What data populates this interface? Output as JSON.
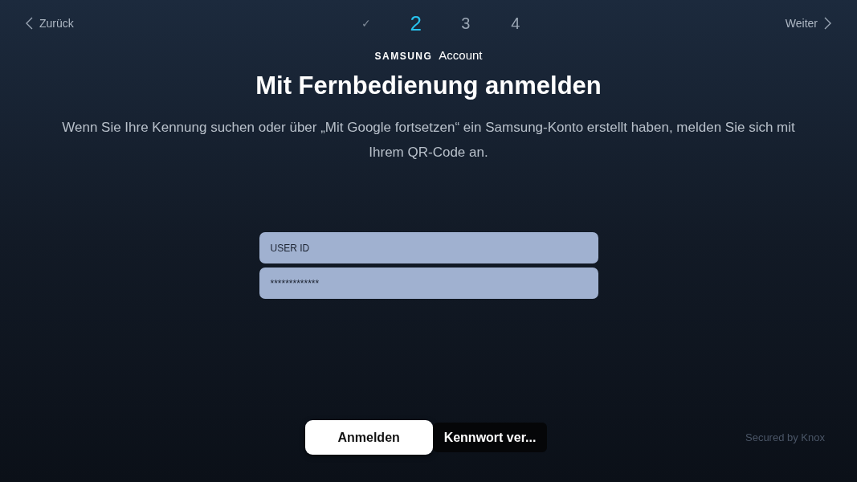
{
  "nav": {
    "back": "Zurück",
    "next": "Weiter"
  },
  "steps": [
    {
      "label": "✓",
      "selected": false
    },
    {
      "label": "2",
      "selected": true
    },
    {
      "label": "3",
      "selected": false
    },
    {
      "label": "4",
      "selected": false
    }
  ],
  "brand": {
    "logo": "SAMSUNG",
    "name": "Account"
  },
  "title": "Mit Fernbedienung anmelden",
  "description": "Wenn Sie Ihre Kennung suchen oder über „Mit Google fortsetzen“ ein Samsung-Konto erstellt haben, melden Sie sich mit Ihrem QR-Code an.",
  "fields": [
    {
      "value": "USER ID"
    },
    {
      "value": "*************"
    }
  ],
  "buttons": [
    {
      "label": "Anmelden",
      "selected": true
    },
    {
      "label": "Kennwort ver...",
      "selected": false
    }
  ],
  "footer": "Secured by Knox"
}
